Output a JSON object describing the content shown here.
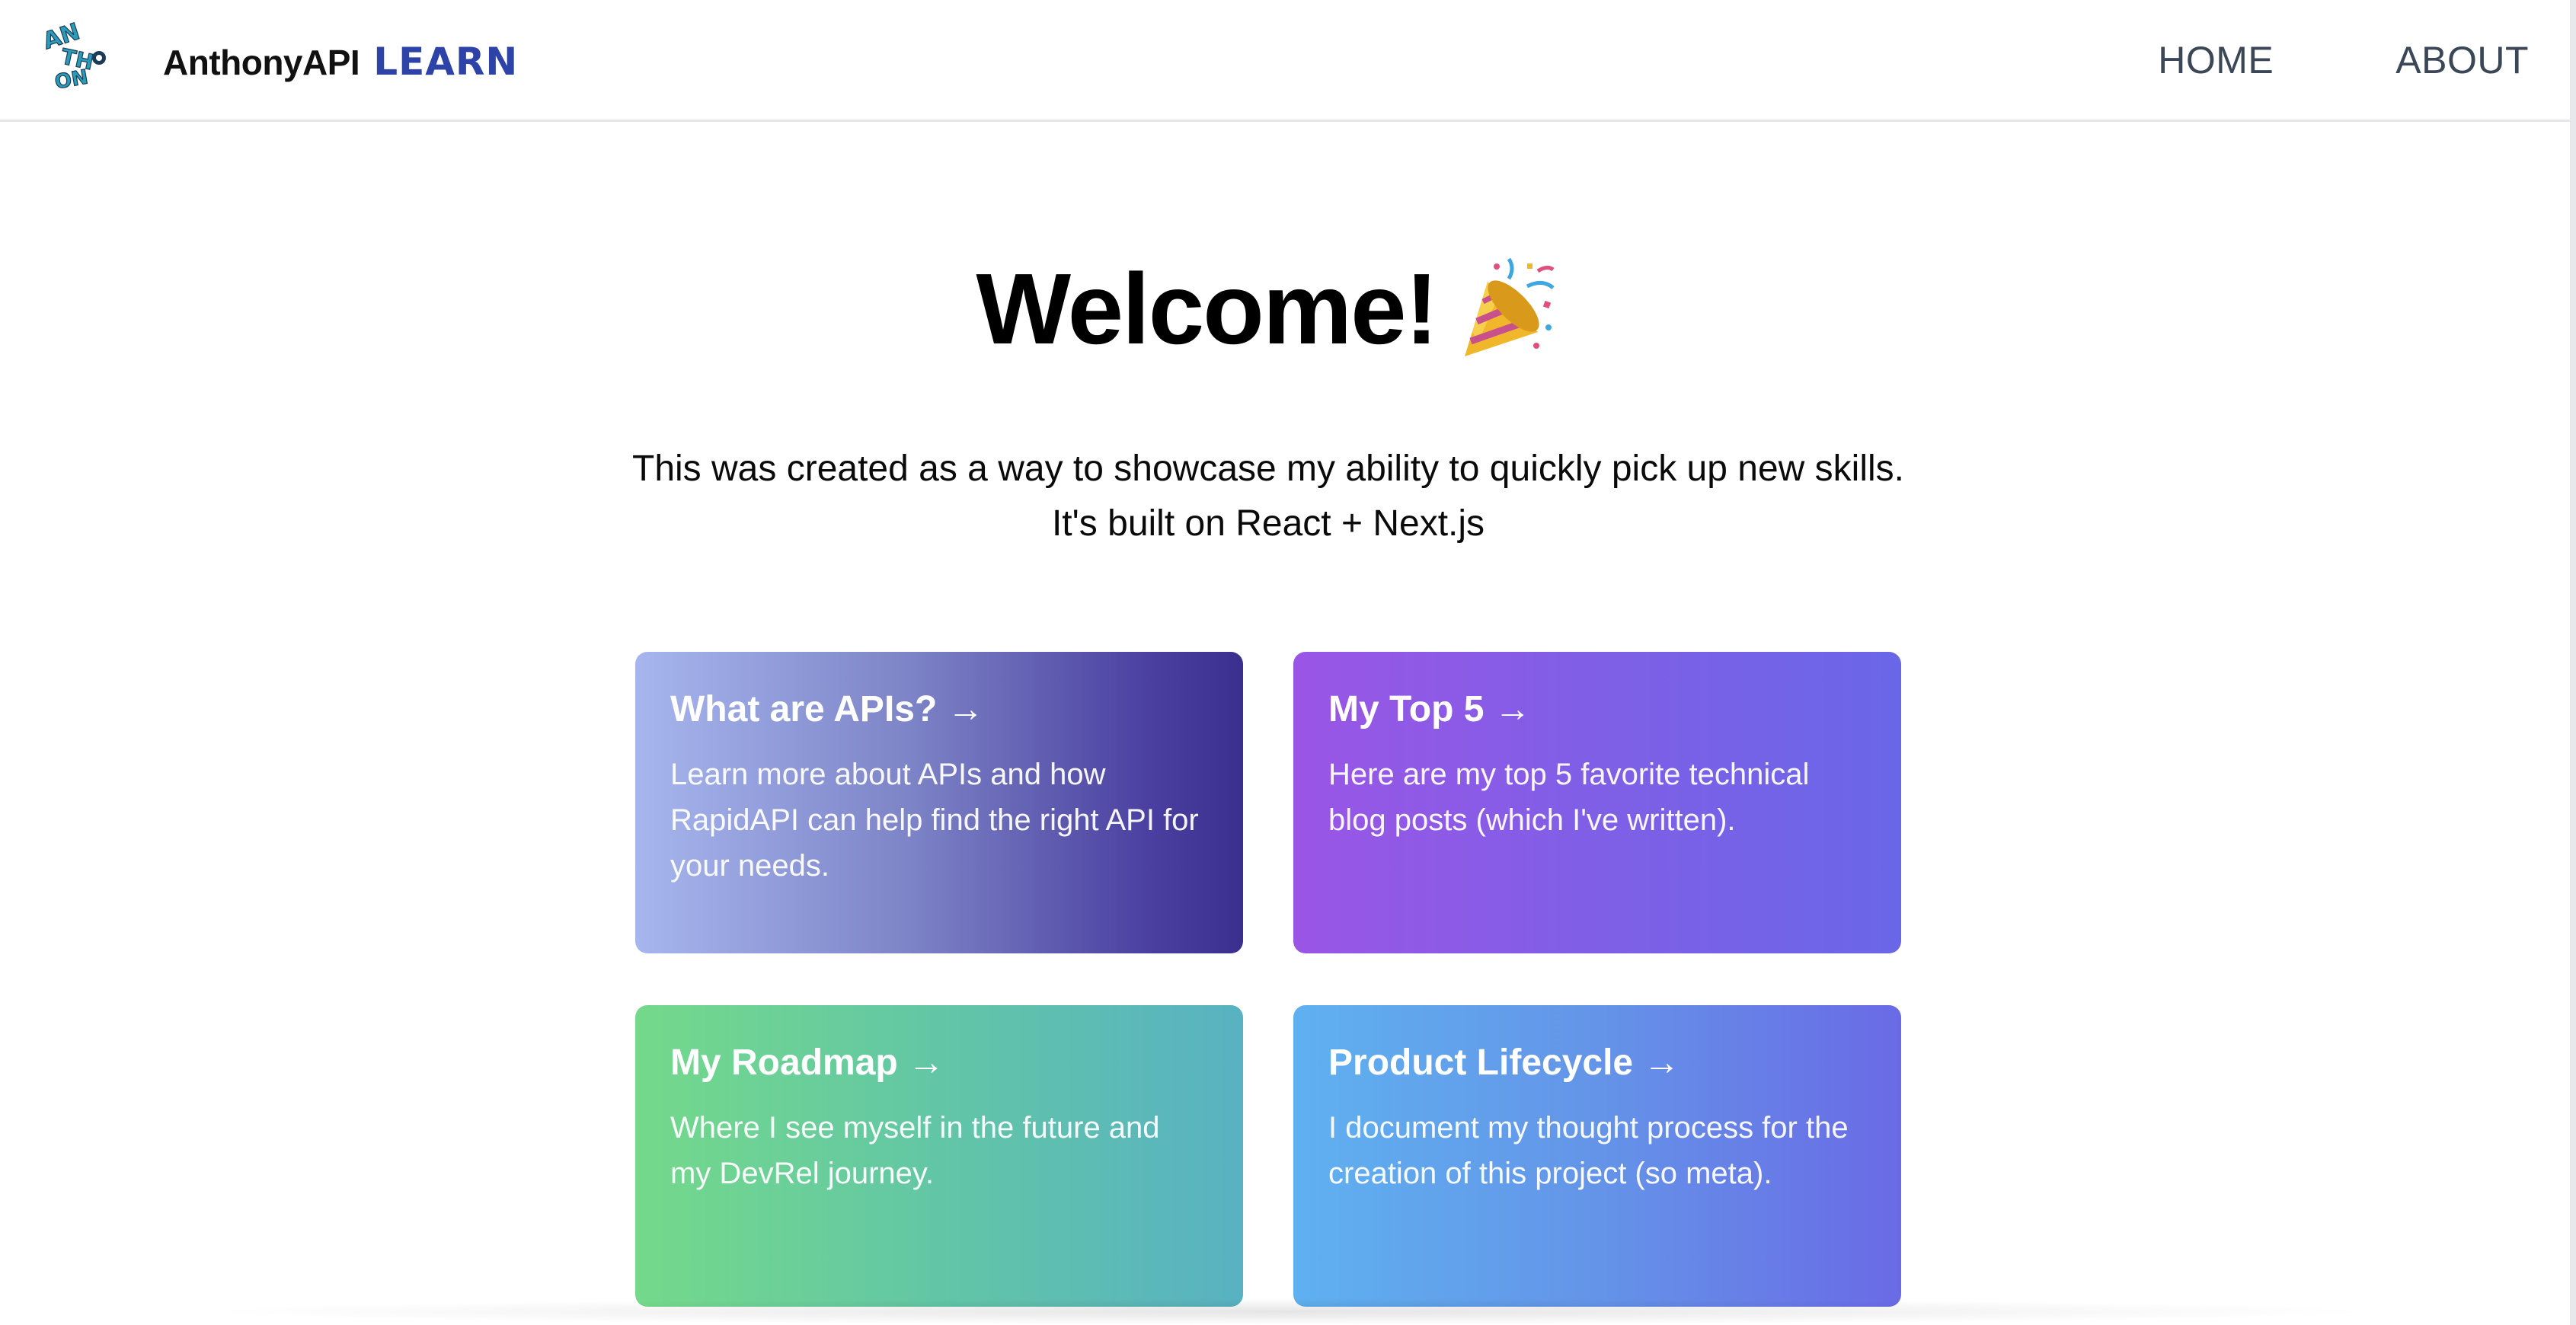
{
  "header": {
    "brand_name": "AnthonyAPI",
    "brand_suffix": "LEARN",
    "logo_icon": "anthony-logo-icon",
    "nav": [
      {
        "label": "HOME"
      },
      {
        "label": "ABOUT"
      }
    ]
  },
  "hero": {
    "title": "Welcome!",
    "emoji_icon": "party-popper-icon",
    "subtitle_line1": "This was created as a way to showcase my ability to quickly pick up new skills.",
    "subtitle_line2": "It's built on React + Next.js"
  },
  "cards": [
    {
      "title": "What are APIs? →",
      "description": "Learn more about APIs and how RapidAPI can help find the right API for your needs."
    },
    {
      "title": "My Top 5 →",
      "description": "Here are my top 5 favorite technical blog posts (which I've written)."
    },
    {
      "title": "My Roadmap →",
      "description": "Where I see myself in the future and my DevRel journey."
    },
    {
      "title": "Product Lifecycle →",
      "description": "I document my thought process for the creation of this project (so meta)."
    }
  ],
  "colors": {
    "brand_accent": "#2d43a8",
    "nav_text": "#3b4656"
  }
}
